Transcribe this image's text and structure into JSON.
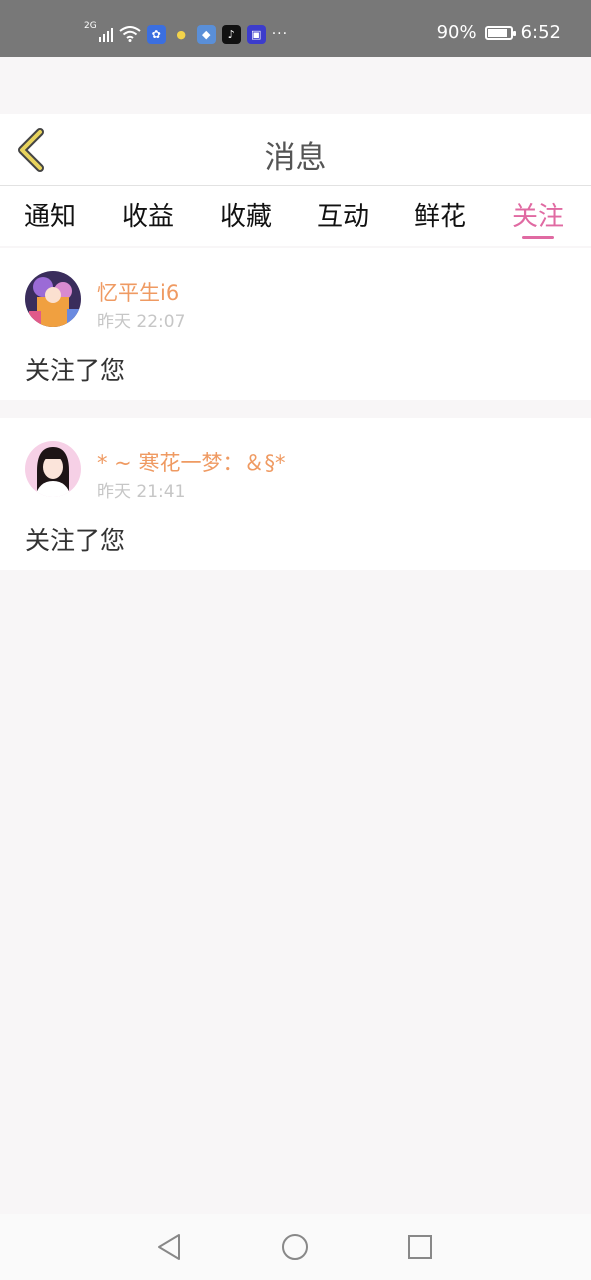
{
  "status_bar": {
    "network": "2G",
    "battery": "90%",
    "battery_level": 0.9,
    "time": "6:52",
    "app_icons": [
      "baidu-icon",
      "lightbulb-icon",
      "fish-icon",
      "tiktok-icon",
      "drama-icon"
    ],
    "more": "···"
  },
  "header": {
    "title": "消息"
  },
  "tabs": [
    {
      "label": "通知"
    },
    {
      "label": "收益"
    },
    {
      "label": "收藏"
    },
    {
      "label": "互动"
    },
    {
      "label": "鲜花"
    },
    {
      "label": "关注",
      "active": true
    }
  ],
  "notifications": [
    {
      "username": "忆平生i6",
      "time": "昨天 22:07",
      "message": "关注了您"
    },
    {
      "username": "* ~ 寒花一梦：＆§*",
      "time": "昨天 21:41",
      "message": "关注了您"
    }
  ],
  "colors": {
    "accent": "#e06aa2",
    "username": "#ef9a62",
    "back_arrow": "#e8d35c",
    "background": "#f8f6f7"
  }
}
